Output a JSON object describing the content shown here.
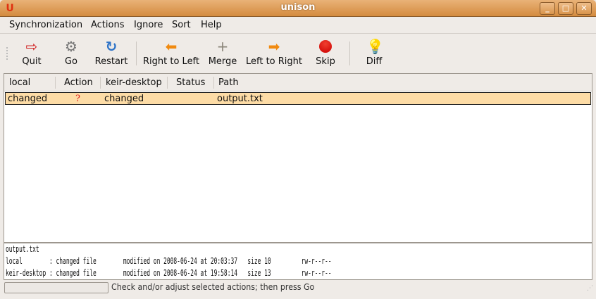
{
  "window": {
    "title": "unison"
  },
  "menu": [
    "Synchronization",
    "Actions",
    "Ignore",
    "Sort",
    "Help"
  ],
  "toolbar": {
    "quit": "Quit",
    "go": "Go",
    "restart": "Restart",
    "right_to_left": "Right to Left",
    "merge": "Merge",
    "left_to_right": "Left to Right",
    "skip": "Skip",
    "diff": "Diff"
  },
  "columns": {
    "local": "local",
    "action": "Action",
    "remote": "keir-desktop",
    "status": "Status",
    "path": "Path"
  },
  "rows": [
    {
      "local": "changed",
      "action": "?",
      "remote": "changed",
      "status": "",
      "path": "output.txt"
    }
  ],
  "details": {
    "filename": "output.txt",
    "line1": "local        : changed file        modified on 2008-06-24 at 20:03:37   size 10         rw-r--r--",
    "line2": "keir-desktop : changed file        modified on 2008-06-24 at 19:58:14   size 13         rw-r--r--"
  },
  "status": {
    "message": "Check and/or adjust selected actions; then press Go",
    "progress": 0
  }
}
